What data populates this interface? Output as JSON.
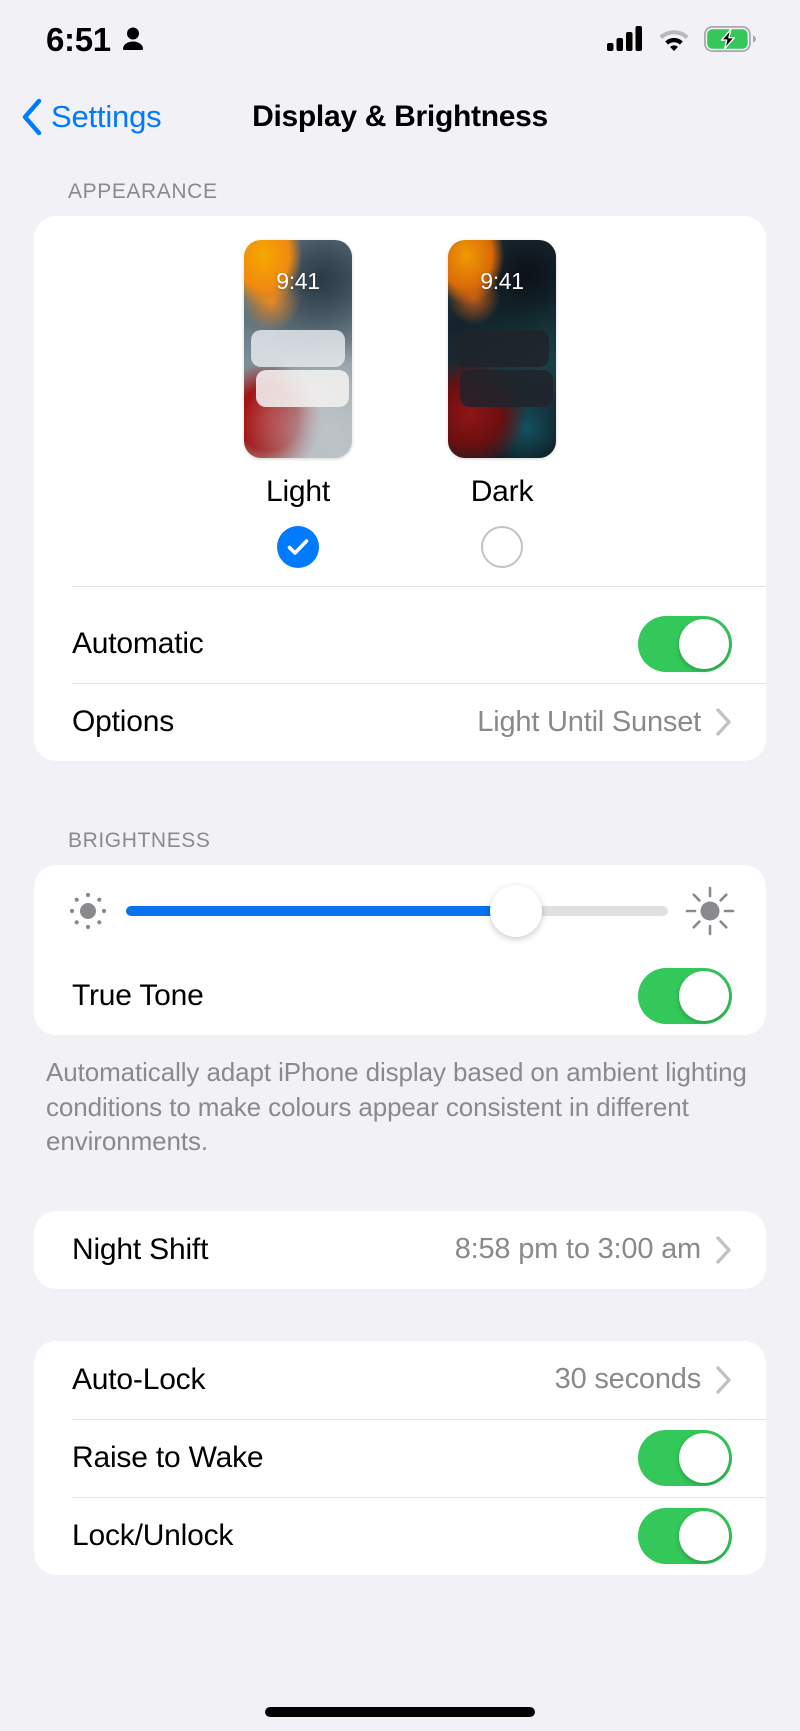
{
  "status_bar": {
    "time": "6:51",
    "person_icon": "person-icon",
    "signal_icon": "cellular-signal-icon",
    "signal_bars": 4,
    "wifi_icon": "wifi-icon",
    "battery_icon": "battery-charging-icon",
    "battery_charging": true
  },
  "nav": {
    "back_label": "Settings",
    "back_icon": "chevron-left-icon",
    "title": "Display & Brightness"
  },
  "appearance": {
    "header": "APPEARANCE",
    "options": [
      {
        "label": "Light",
        "selected": true,
        "clock": "9:41"
      },
      {
        "label": "Dark",
        "selected": false,
        "clock": "9:41"
      }
    ],
    "rows": [
      {
        "label": "Automatic",
        "type": "toggle",
        "value": "on"
      },
      {
        "label": "Options",
        "type": "disclosure",
        "value": "Light Until Sunset"
      }
    ]
  },
  "brightness": {
    "header": "BRIGHTNESS",
    "slider": {
      "min_icon": "brightness-low-icon",
      "max_icon": "brightness-high-icon",
      "percent": 72
    },
    "true_tone": {
      "label": "True Tone",
      "value": "on"
    },
    "footnote": "Automatically adapt iPhone display based on ambient lighting conditions to make colours appear consistent in different environments."
  },
  "night_shift": {
    "label": "Night Shift",
    "value": "8:58 pm to 3:00 am"
  },
  "lock_section": {
    "rows": [
      {
        "label": "Auto-Lock",
        "type": "disclosure",
        "value": "30 seconds"
      },
      {
        "label": "Raise to Wake",
        "type": "toggle",
        "value": "on"
      },
      {
        "label": "Lock/Unlock",
        "type": "toggle",
        "value": "on"
      }
    ]
  },
  "colors": {
    "accent_blue": "#007aff",
    "toggle_green": "#34c759",
    "slider_blue": "#0a72f0",
    "secondary_text": "#8a8a8e",
    "background": "#f2f1f6"
  }
}
